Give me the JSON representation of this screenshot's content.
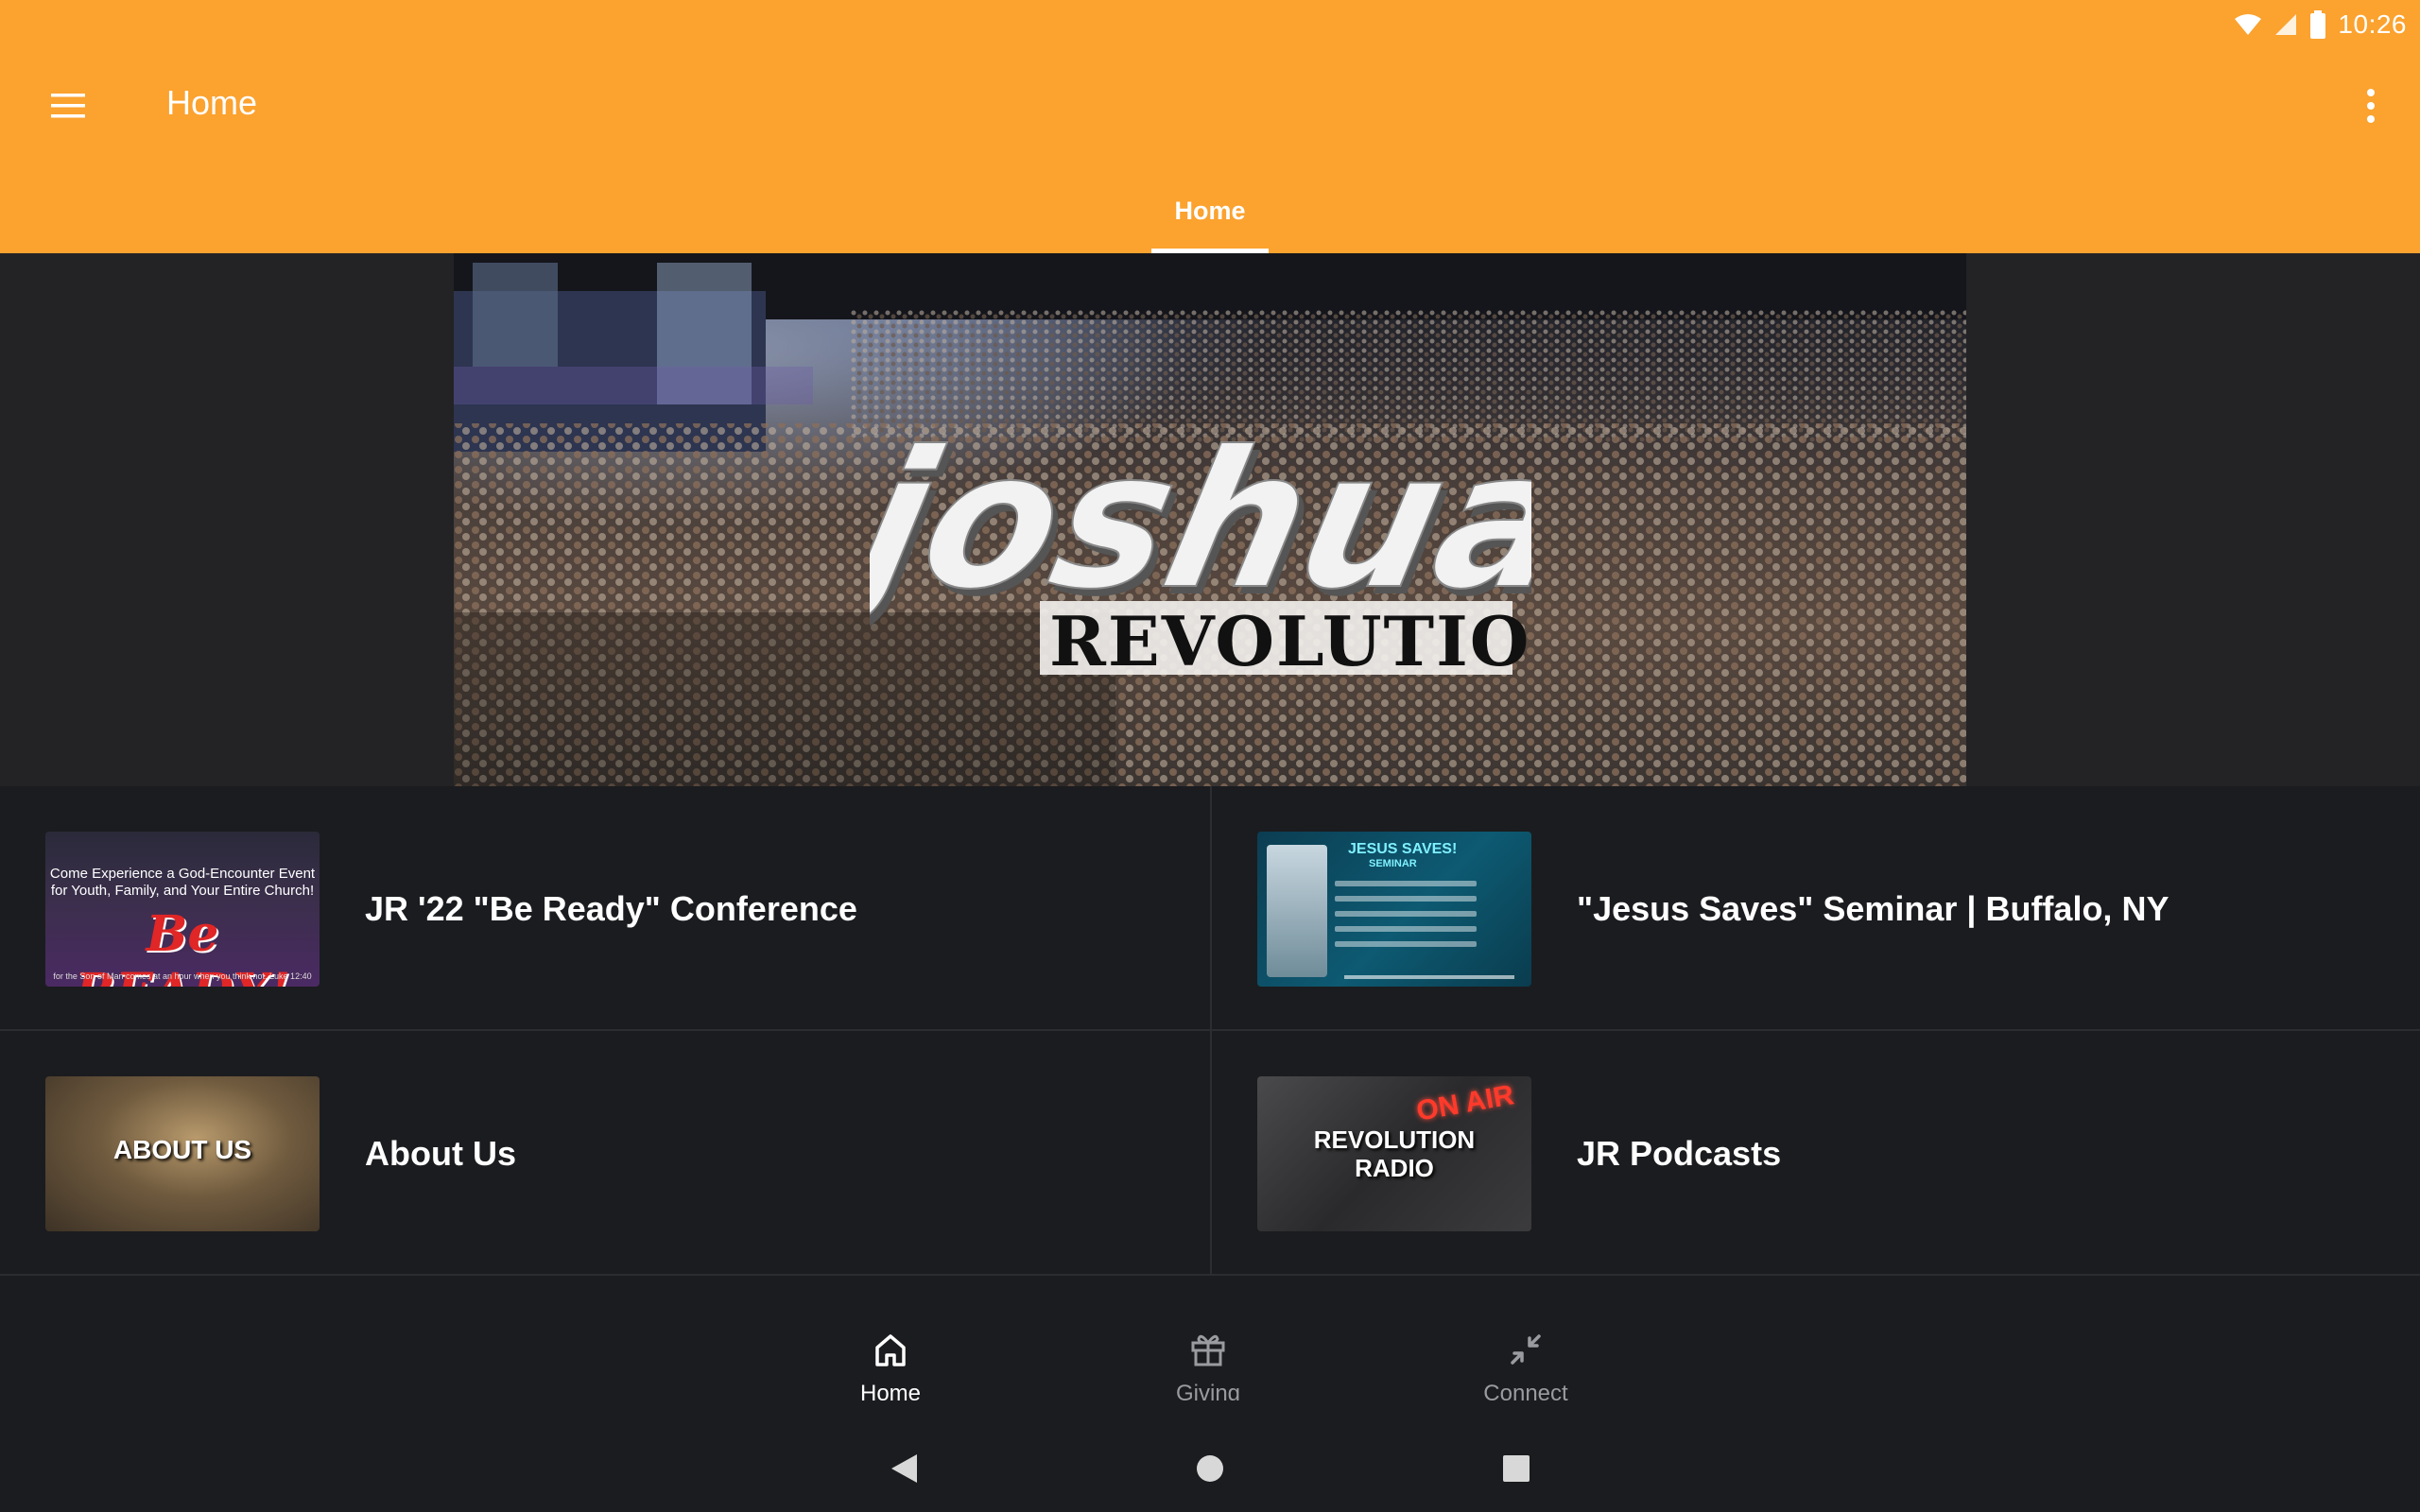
{
  "status_bar": {
    "time": "10:26",
    "icons": [
      "wifi-icon",
      "cellular-signal-icon",
      "battery-icon"
    ]
  },
  "app_bar": {
    "title": "Home",
    "menu_icon": "hamburger-menu-icon",
    "overflow_icon": "more-vert-icon"
  },
  "tabs": [
    {
      "label": "Home",
      "selected": true
    }
  ],
  "hero": {
    "logo_line1": "joshua",
    "logo_line2": "REVOLUTION"
  },
  "items": [
    {
      "title": "JR '22 \"Be Ready\" Conference",
      "thumb": {
        "line1": "Come Experience a God-Encounter Event",
        "line2": "for Youth, Family, and Your Entire Church!",
        "big": "Be READY!",
        "foot": "for the Son of Man comes at an hour when you think not. Luke 12:40"
      }
    },
    {
      "title": "\"Jesus Saves\" Seminar | Buffalo, NY",
      "thumb": {
        "heading": "JESUS SAVES!",
        "sub": "SEMINAR"
      }
    },
    {
      "title": "About Us",
      "thumb": {
        "caption": "ABOUT US"
      }
    },
    {
      "title": "JR Podcasts",
      "thumb": {
        "onair": "ON AIR",
        "caption1": "REVOLUTION",
        "caption2": "RADIO"
      }
    }
  ],
  "bottom_nav": [
    {
      "label": "Home",
      "icon": "home-icon",
      "active": true
    },
    {
      "label": "Giving",
      "icon": "gift-icon",
      "active": false
    },
    {
      "label": "Connect",
      "icon": "collapse-arrows-icon",
      "active": false
    }
  ],
  "colors": {
    "accent": "#fba22f",
    "background": "#1b1c1f",
    "hero_bg": "#232325"
  }
}
